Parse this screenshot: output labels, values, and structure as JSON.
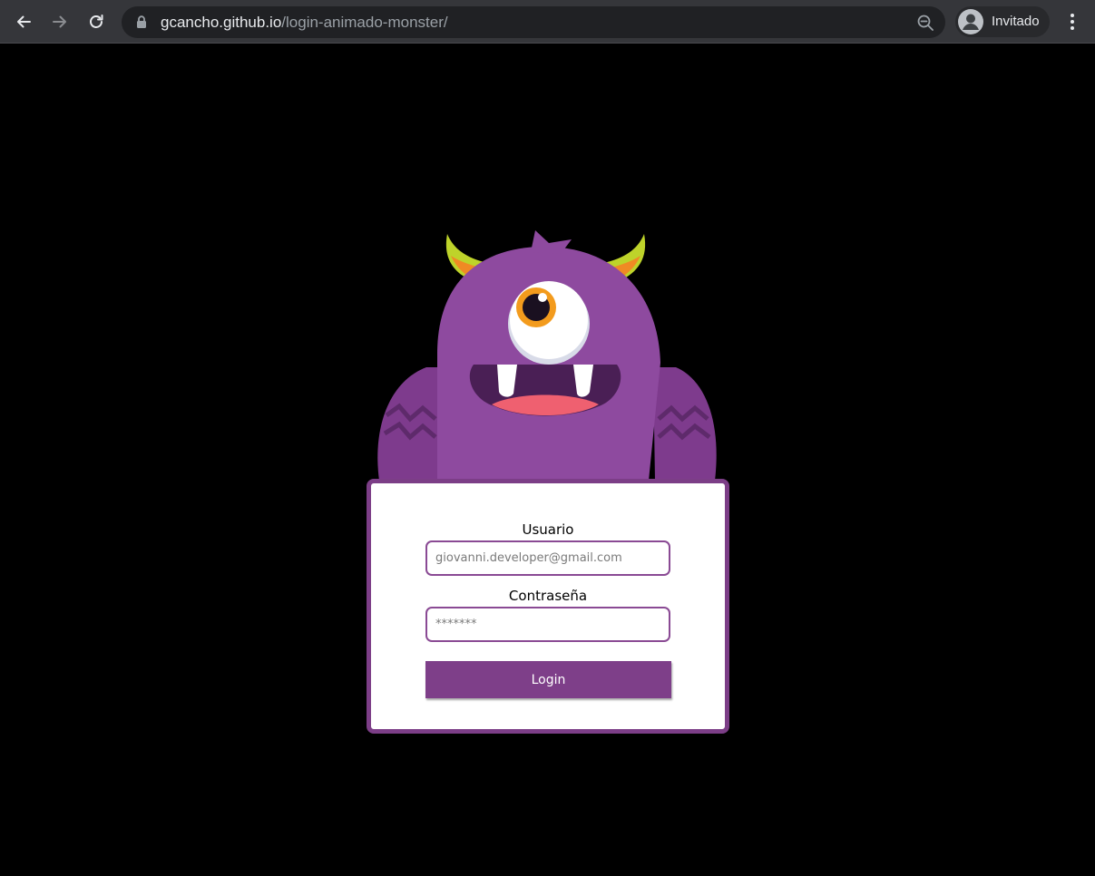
{
  "browser": {
    "url_host": "gcancho.github.io",
    "url_path": "/login-animado-monster/",
    "profile_label": "Invitado",
    "icons": [
      "back-arrow-icon",
      "forward-arrow-icon",
      "reload-icon",
      "lock-icon",
      "zoom-out-icon",
      "avatar-icon",
      "kebab-menu-icon"
    ]
  },
  "login": {
    "user_label": "Usuario",
    "user_placeholder": "giovanni.developer@gmail.com",
    "password_label": "Contraseña",
    "password_placeholder": "*******",
    "button_label": "Login"
  },
  "colors": {
    "page_background": "#000000",
    "monster_body": "#8e4a9f",
    "card_border": "#7c3e87",
    "button": "#7e3f89",
    "horn_orange": "#f08a24",
    "horn_green": "#bed32a",
    "mouth_tongue": "#ef6070"
  }
}
